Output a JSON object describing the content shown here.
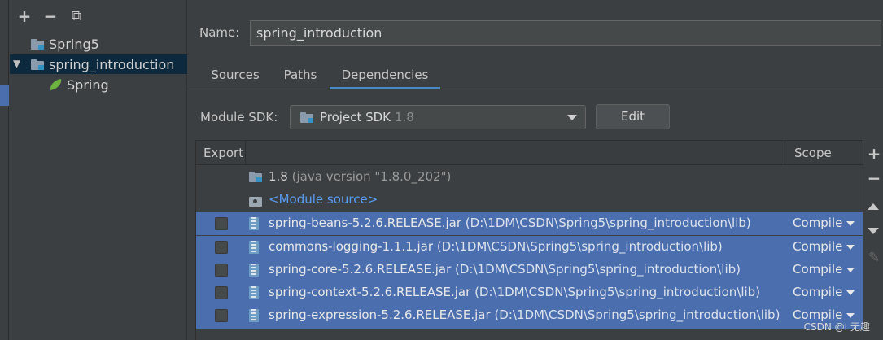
{
  "tree": {
    "toolbar": {
      "add": "+",
      "remove": "−",
      "copy": "⧉"
    },
    "items": [
      {
        "label": "Spring5"
      },
      {
        "label": "spring_introduction"
      },
      {
        "label": "Spring"
      }
    ]
  },
  "form": {
    "name_label": "Name:",
    "name_value": "spring_introduction"
  },
  "tabs": [
    {
      "label": "Sources"
    },
    {
      "label": "Paths"
    },
    {
      "label": "Dependencies"
    }
  ],
  "sdk": {
    "label": "Module SDK:",
    "value": "Project SDK",
    "version": "1.8",
    "edit_label": "Edit"
  },
  "table": {
    "headers": {
      "export": "Export",
      "scope": "Scope"
    },
    "rows": [
      {
        "name": "1.8",
        "detail": "(java version \"1.8.0_202\")"
      },
      {
        "name": "<Module source>"
      },
      {
        "name": "spring-beans-5.2.6.RELEASE.jar",
        "detail": "(D:\\1DM\\CSDN\\Spring5\\spring_introduction\\lib)",
        "scope": "Compile"
      },
      {
        "name": "commons-logging-1.1.1.jar",
        "detail": "(D:\\1DM\\CSDN\\Spring5\\spring_introduction\\lib)",
        "scope": "Compile"
      },
      {
        "name": "spring-core-5.2.6.RELEASE.jar",
        "detail": "(D:\\1DM\\CSDN\\Spring5\\spring_introduction\\lib)",
        "scope": "Compile"
      },
      {
        "name": "spring-context-5.2.6.RELEASE.jar",
        "detail": "(D:\\1DM\\CSDN\\Spring5\\spring_introduction\\lib)",
        "scope": "Compile"
      },
      {
        "name": "spring-expression-5.2.6.RELEASE.jar",
        "detail": "(D:\\1DM\\CSDN\\Spring5\\spring_introduction\\lib)",
        "scope": "Compile"
      }
    ]
  },
  "side_toolbar": {
    "add": "+",
    "remove": "−",
    "edit": "✎"
  },
  "watermark": "CSDN @I 无趣",
  "colors": {
    "selection": "#4b6eaf",
    "tab_underline": "#4a88c7",
    "link": "#589df6",
    "spring_leaf": "#6db33f"
  }
}
